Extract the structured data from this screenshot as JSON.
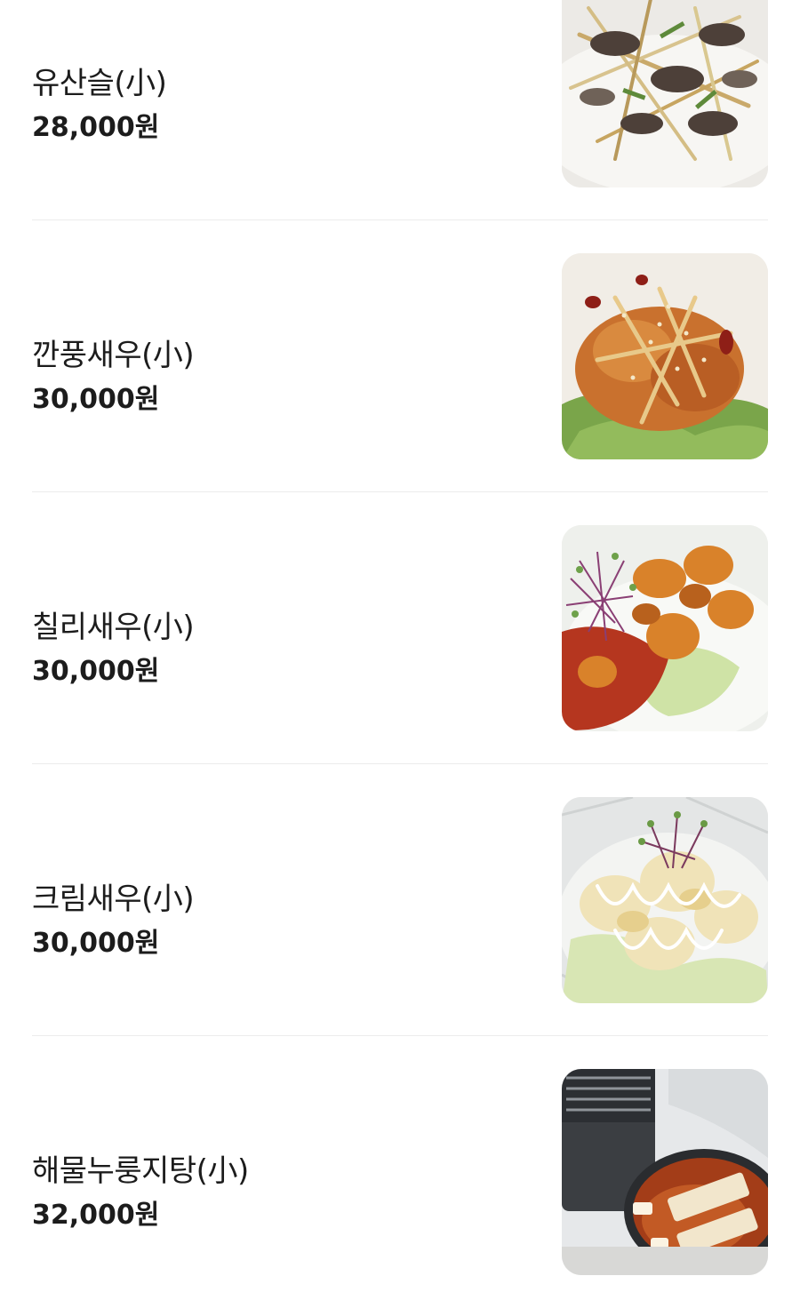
{
  "menu": {
    "items": [
      {
        "name": "유산슬(小)",
        "price": "28,000원",
        "photo": "yusanseul-dish-photo"
      },
      {
        "name": "깐풍새우(小)",
        "price": "30,000원",
        "photo": "kkanpung-shrimp-dish-photo"
      },
      {
        "name": "칠리새우(小)",
        "price": "30,000원",
        "photo": "chili-shrimp-dish-photo"
      },
      {
        "name": "크림새우(小)",
        "price": "30,000원",
        "photo": "cream-shrimp-dish-photo"
      },
      {
        "name": "해물누룽지탕(小)",
        "price": "32,000원",
        "photo": "seafood-nurungji-soup-photo"
      }
    ]
  },
  "colors": {
    "text": "#1c1c1c",
    "divider": "#ececec",
    "background": "#ffffff"
  }
}
